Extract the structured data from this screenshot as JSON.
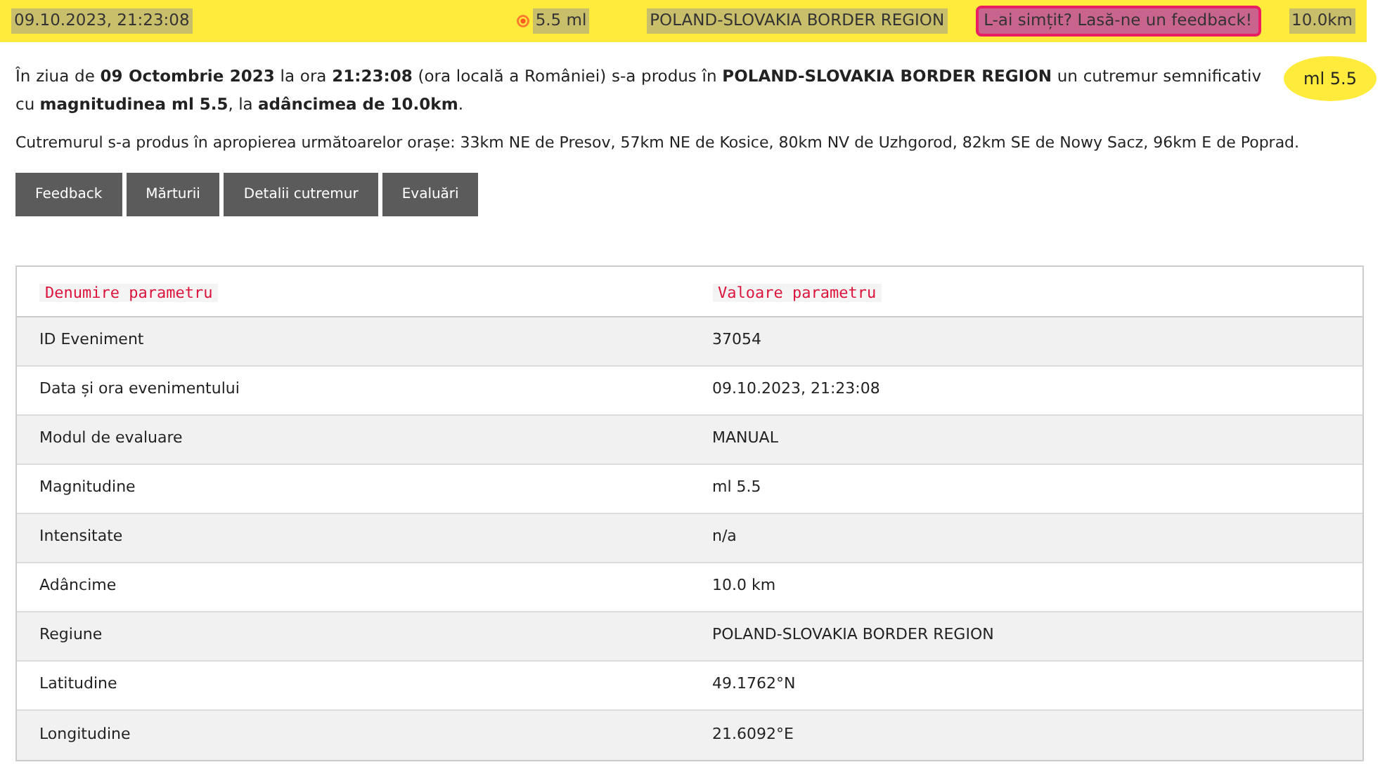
{
  "top_bar": {
    "datetime": "09.10.2023, 21:23:08",
    "magnitude": "5.5 ml",
    "region": "POLAND-SLOVAKIA BORDER REGION",
    "feedback_link": "L-ai simțit? Lasă-ne un feedback!",
    "depth": "10.0km"
  },
  "summary": "În ziua de **09 Octombrie 2023** la ora **21:23:08** (ora locală a României) s-a produs în **POLAND-SLOVAKIA BORDER REGION** un cutremur semnificativ cu **magnitudinea ml 5.5**, la **adâncimea de 10.0km**.",
  "magnitude_badge": "ml 5.5",
  "nearby": "Cutremurul s-a produs în apropierea următoarelor orașe: 33km NE de Presov, 57km NE de Kosice, 80km NV de Uzhgorod, 82km SE de Nowy Sacz, 96km E de Poprad.",
  "buttons": [
    "Feedback",
    "Mărturii",
    "Detalii cutremur",
    "Evaluări"
  ],
  "table": {
    "columns": [
      "Denumire parametru",
      "Valoare parametru"
    ],
    "rows": [
      [
        "ID Eveniment",
        "37054"
      ],
      [
        "Data și ora evenimentului",
        "09.10.2023, 21:23:08"
      ],
      [
        "Modul de evaluare",
        "MANUAL"
      ],
      [
        "Magnitudine",
        "ml 5.5"
      ],
      [
        "Intensitate",
        "n/a"
      ],
      [
        "Adâncime",
        "10.0 km"
      ],
      [
        "Regiune",
        "POLAND-SLOVAKIA BORDER REGION"
      ],
      [
        "Latitudine",
        "49.1762°N"
      ],
      [
        "Longitudine",
        "21.6092°E"
      ]
    ]
  }
}
